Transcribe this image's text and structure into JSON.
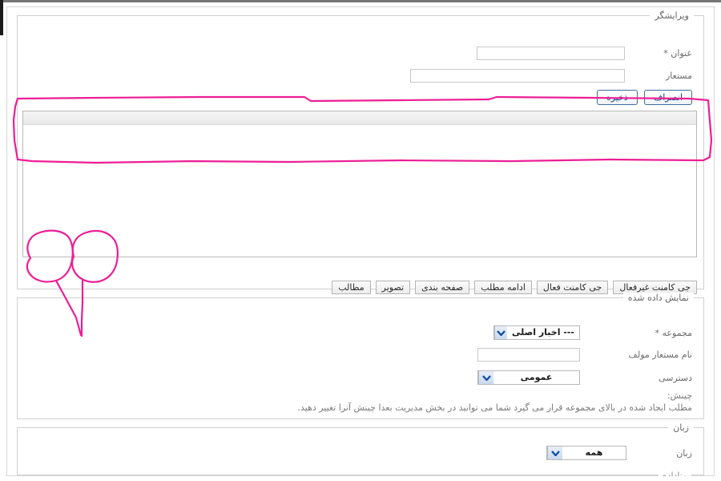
{
  "editor_section": {
    "legend": "ویرایشگر",
    "fields": {
      "title_label": "عنوان *",
      "title_value": "",
      "alias_label": "مستعار",
      "alias_value": ""
    },
    "buttons": {
      "cancel_label": "انصراف",
      "save_label": "ذخیره"
    },
    "insert_toolbar": [
      {
        "label": "جی کامنت غیرفعال"
      },
      {
        "label": "جی کامنت فعال"
      },
      {
        "label": "ادامه مطلب"
      },
      {
        "label": "صفحه بندی"
      },
      {
        "label": "تصویر"
      },
      {
        "label": "مطالب"
      }
    ]
  },
  "display_section": {
    "legend": "نمایش داده شده",
    "category_label": "مجموعه *",
    "category_value": "--- اخبار اصلی",
    "author_alias_label": "نام مستعار مولف",
    "author_alias_value": "",
    "access_label": "دسترسی",
    "access_value": "عمومی",
    "order_hint_title": "چینش:",
    "order_hint_text": "مطلب ایجاد شده در بالای مجموعه قرار می گیرد شما می توانید در بخش مدیریت بعدا چینش آنرا تغییر دهید."
  },
  "language_section": {
    "legend": "زبان",
    "language_label": "زبان",
    "language_value": "همه"
  },
  "bottom_section": {
    "legend": "متاداده"
  },
  "annotation": {
    "color": "#ED1E95",
    "marks": [
      {
        "name": "editor-toolbar-highlight",
        "shape": "rectangle"
      },
      {
        "name": "articles-button-circle",
        "shape": "circle"
      },
      {
        "name": "image-button-circle",
        "shape": "circle"
      }
    ]
  }
}
